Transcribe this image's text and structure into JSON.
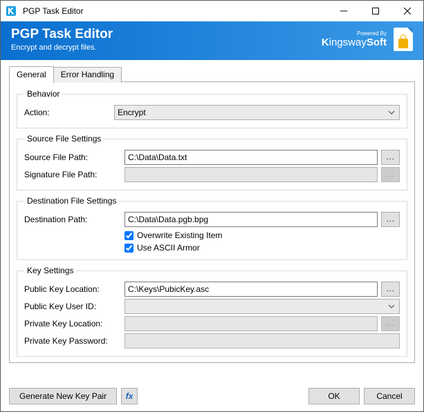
{
  "titlebar": {
    "title": "PGP Task Editor"
  },
  "header": {
    "title": "PGP Task Editor",
    "subtitle": "Encrypt and decrypt files.",
    "powered_by": "Powered By",
    "brand": "KingswaySoft"
  },
  "tabs": {
    "general": "General",
    "error": "Error Handling"
  },
  "behavior": {
    "legend": "Behavior",
    "action_label": "Action:",
    "action_value": "Encrypt"
  },
  "source": {
    "legend": "Source File Settings",
    "src_label": "Source File Path:",
    "src_value": "C:\\Data\\Data.txt",
    "sig_label": "Signature File Path:",
    "sig_value": ""
  },
  "dest": {
    "legend": "Destination File Settings",
    "dest_label": "Destination Path:",
    "dest_value": "C:\\Data\\Data.pgb.bpg",
    "overwrite_label": "Overwrite Existing Item",
    "ascii_label": "Use ASCII Armor"
  },
  "key": {
    "legend": "Key Settings",
    "pub_loc_label": "Public Key Location:",
    "pub_loc_value": "C:\\Keys\\PubicKey.asc",
    "pub_uid_label": "Public Key User ID:",
    "pub_uid_value": "",
    "priv_loc_label": "Private Key Location:",
    "priv_loc_value": "",
    "priv_pwd_label": "Private Key Password:",
    "priv_pwd_value": ""
  },
  "footer": {
    "generate": "Generate New Key Pair",
    "fx": "fx",
    "ok": "OK",
    "cancel": "Cancel"
  },
  "browse": "..."
}
